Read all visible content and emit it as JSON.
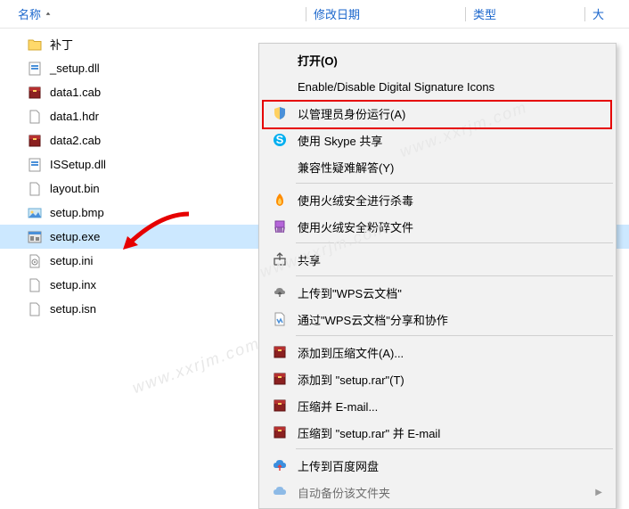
{
  "header": {
    "name": "名称",
    "date": "修改日期",
    "type": "类型",
    "size": "大"
  },
  "files": [
    {
      "name": "补丁",
      "icon": "folder"
    },
    {
      "name": "_setup.dll",
      "icon": "dll"
    },
    {
      "name": "data1.cab",
      "icon": "archive"
    },
    {
      "name": "data1.hdr",
      "icon": "file"
    },
    {
      "name": "data2.cab",
      "icon": "archive"
    },
    {
      "name": "ISSetup.dll",
      "icon": "dll"
    },
    {
      "name": "layout.bin",
      "icon": "file"
    },
    {
      "name": "setup.bmp",
      "icon": "image"
    },
    {
      "name": "setup.exe",
      "icon": "exe",
      "selected": true
    },
    {
      "name": "setup.ini",
      "icon": "ini"
    },
    {
      "name": "setup.inx",
      "icon": "file"
    },
    {
      "name": "setup.isn",
      "icon": "file"
    }
  ],
  "menu": {
    "open": "打开(O)",
    "enable_disable": "Enable/Disable Digital Signature Icons",
    "run_as_admin": "以管理员身份运行(A)",
    "skype_share": "使用 Skype 共享",
    "compat_troubleshoot": "兼容性疑难解答(Y)",
    "huorong_scan": "使用火绒安全进行杀毒",
    "huorong_shred": "使用火绒安全粉碎文件",
    "share": "共享",
    "wps_upload": "上传到\"WPS云文档\"",
    "wps_collab": "通过\"WPS云文档\"分享和协作",
    "rar_add": "添加到压缩文件(A)...",
    "rar_add_to": "添加到 \"setup.rar\"(T)",
    "rar_email": "压缩并 E-mail...",
    "rar_email_to": "压缩到 \"setup.rar\" 并 E-mail",
    "baidu_upload": "上传到百度网盘",
    "baidu_backup": "自动备份该文件夹"
  },
  "watermark": "www.xxrjm.com"
}
